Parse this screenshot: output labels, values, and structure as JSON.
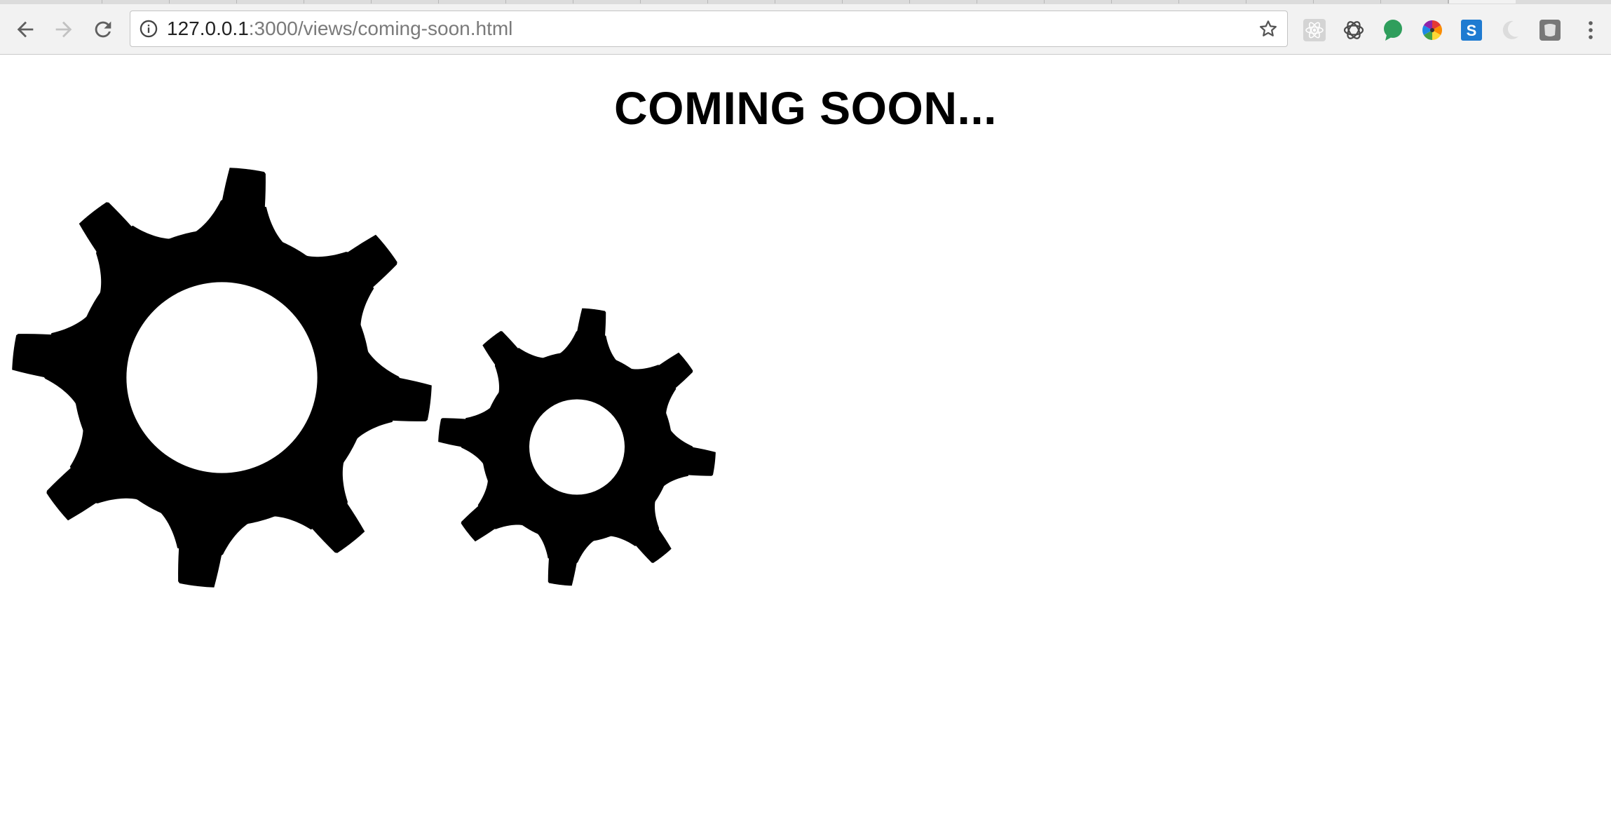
{
  "browser": {
    "url_host": "127.0.0.1",
    "url_path": ":3000/views/coming-soon.html",
    "icons": {
      "back": "arrow-left-icon",
      "forward": "arrow-right-icon",
      "reload": "reload-icon",
      "info": "info-icon",
      "bookmark": "star-icon",
      "menu": "kebab-menu-icon"
    },
    "extensions": [
      "react-devtools-icon",
      "chatgpt-icon",
      "green-chat-icon",
      "color-wheel-icon",
      "s-icon",
      "moon-icon",
      "grey-square-icon"
    ]
  },
  "page": {
    "title": "COMING SOON...",
    "icons": [
      "gear-icon",
      "gear-icon"
    ],
    "colors": {
      "background": "#ffffff",
      "text": "#000000",
      "gear": "#000000"
    }
  }
}
